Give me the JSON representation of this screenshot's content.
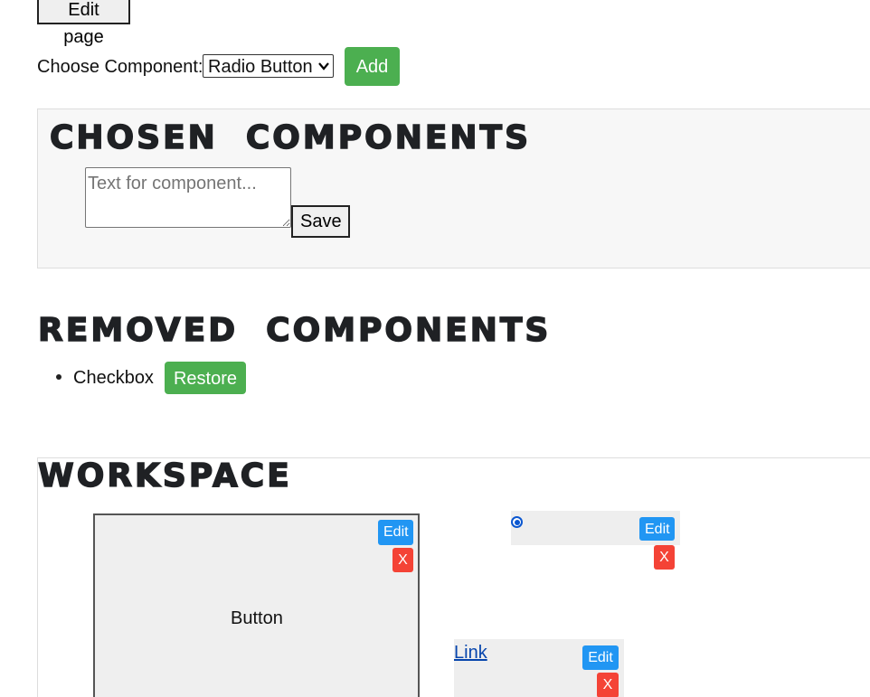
{
  "toolbar": {
    "edit_page_label": "Edit page"
  },
  "chooser": {
    "label": "Choose Component:",
    "selected_option": "Radio Button",
    "add_label": "Add"
  },
  "chosen": {
    "title": "CHOSEN  COMPONENTS",
    "textarea_placeholder": "Text for component...",
    "save_label": "Save"
  },
  "removed": {
    "title": "REMOVED  COMPONENTS",
    "items": [
      {
        "label": "Checkbox",
        "restore_label": "Restore"
      }
    ]
  },
  "workspace": {
    "title": "WORKSPACE",
    "components": {
      "button": {
        "text": "Button",
        "edit_label": "Edit",
        "remove_label": "X"
      },
      "radio": {
        "checked": true,
        "edit_label": "Edit",
        "remove_label": "X"
      },
      "link": {
        "text": "Link",
        "edit_label": "Edit",
        "remove_label": "X"
      }
    }
  },
  "colors": {
    "add_green": "#4caf50",
    "edit_blue": "#2196f3",
    "remove_red": "#f44336",
    "link_blue": "#0645ad",
    "heading_dark": "#1f2124"
  }
}
